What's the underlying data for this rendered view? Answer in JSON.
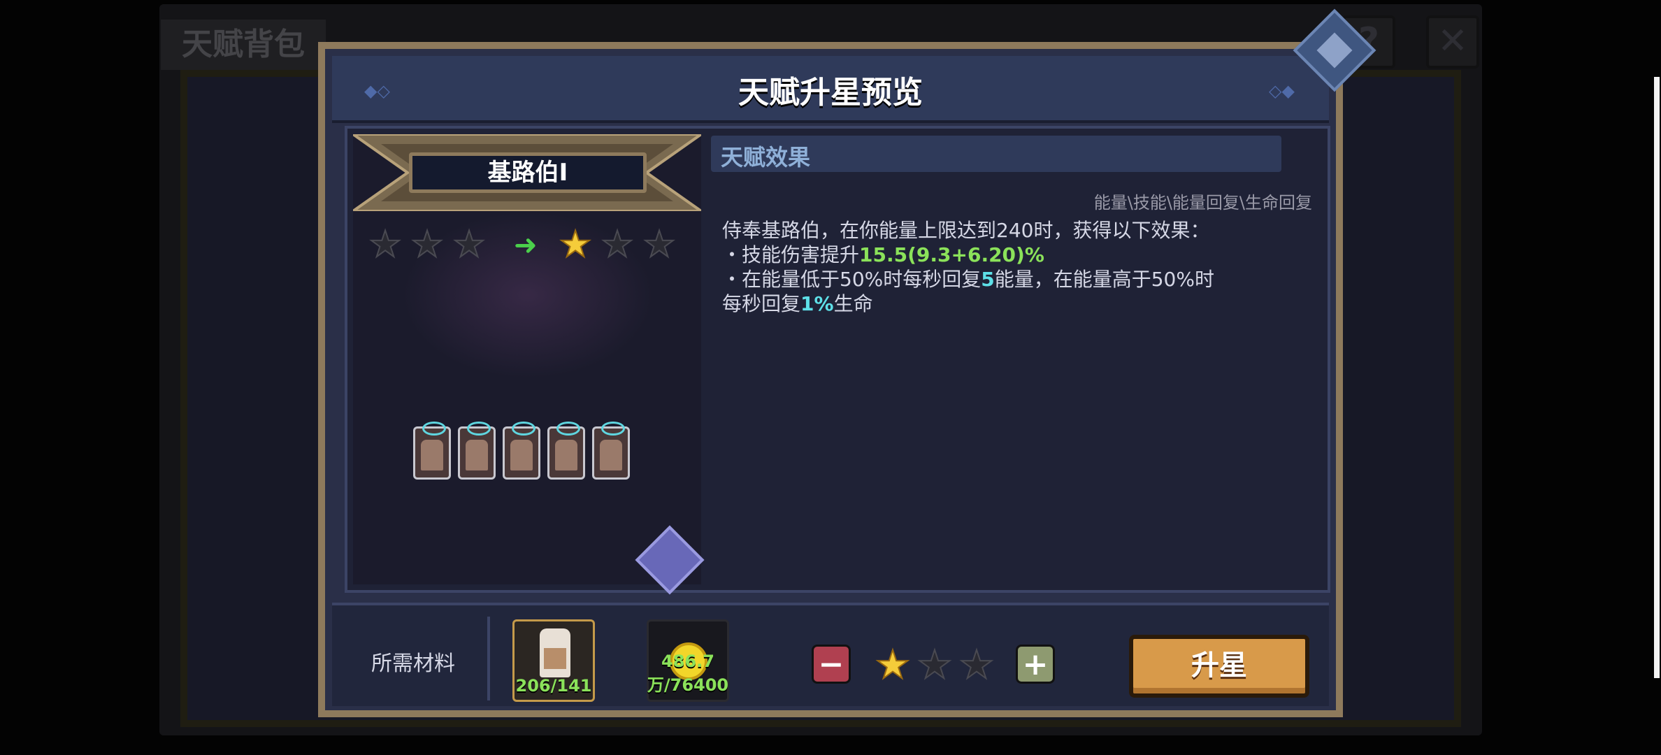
{
  "background": {
    "window_title": "天赋背包",
    "help_icon": "question-icon",
    "close_icon": "close-x-icon"
  },
  "modal": {
    "title": "天赋升星预览",
    "talent_name": "基路伯I",
    "current_stars": 0,
    "next_stars": 1,
    "max_stars": 3,
    "effect_title": "天赋效果",
    "tags": "能量\\技能\\能量回复\\生命回复",
    "desc_line1": "侍奉基路伯，在你能量上限达到240时，获得以下效果：",
    "desc_b1_prefix": "・技能伤害提升",
    "desc_b1_value": "15.5(9.3+6.20)%",
    "desc_b2_prefix": "・在能量低于50%时每秒回复",
    "desc_b2_value": "5",
    "desc_b2_mid": "能量，在能量高于50%时",
    "desc_b2_line2_prefix": "每秒回复",
    "desc_b2_line2_value": "1%",
    "desc_b2_line2_suffix": "生命",
    "unit_count": 5,
    "swap_icon": "swap-arrows-icon"
  },
  "footer": {
    "required_label": "所需材料",
    "material1_count": "206/141",
    "material2_count": "486.7万/76400",
    "selected_stars": 1,
    "star_total": 3,
    "upgrade_label": "升星"
  },
  "colors": {
    "frame": "#8e7a5c",
    "highlight_green": "#8be25a",
    "highlight_cyan": "#5ee0e8",
    "upgrade_button": "#d89a4a"
  }
}
